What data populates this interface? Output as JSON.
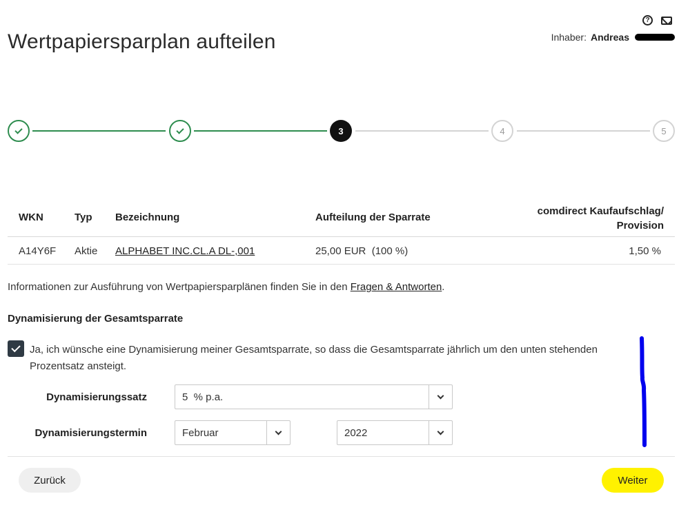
{
  "header": {
    "title": "Wertpapiersparplan aufteilen",
    "owner_label": "Inhaber:",
    "owner_name": "Andreas",
    "icons": [
      "help-icon",
      "mail-icon"
    ]
  },
  "stepper": {
    "steps": [
      {
        "label": "1",
        "state": "done"
      },
      {
        "label": "2",
        "state": "done"
      },
      {
        "label": "3",
        "state": "active"
      },
      {
        "label": "4",
        "state": "todo"
      },
      {
        "label": "5",
        "state": "todo"
      }
    ],
    "done_color": "#2d8c4e",
    "todo_color": "#d3d3d3"
  },
  "table": {
    "headers": {
      "wkn": "WKN",
      "typ": "Typ",
      "bezeichnung": "Bezeichnung",
      "aufteilung": "Aufteilung der Sparrate",
      "aufschlag_line1": "comdirect Kaufaufschlag/",
      "aufschlag_line2": "Provision"
    },
    "rows": [
      {
        "wkn": "A14Y6F",
        "typ": "Aktie",
        "bezeichnung": "ALPHABET INC.CL.A DL-,001",
        "aufteilung": "25,00 EUR  (100 %)",
        "aufschlag": "1,50 %"
      }
    ]
  },
  "info": {
    "text": "Informationen zur Ausführung von Wertpapiersparplänen finden Sie in den ",
    "link": "Fragen & Antworten",
    "suffix": "."
  },
  "dynamisierung": {
    "title": "Dynamisierung der Gesamtsparrate",
    "checkbox_checked": true,
    "checkbox_text": "Ja, ich wünsche eine Dynamisierung meiner Gesamtsparrate, so dass die Gesamtsparrate jährlich um den unten stehenden Prozentsatz ansteigt.",
    "satz_label": "Dynamisierungssatz",
    "satz_value": "5  % p.a.",
    "termin_label": "Dynamisierungstermin",
    "termin_month": "Februar",
    "termin_year": "2022"
  },
  "footer": {
    "back_label": "Zurück",
    "next_label": "Weiter",
    "next_color": "#fff200"
  }
}
